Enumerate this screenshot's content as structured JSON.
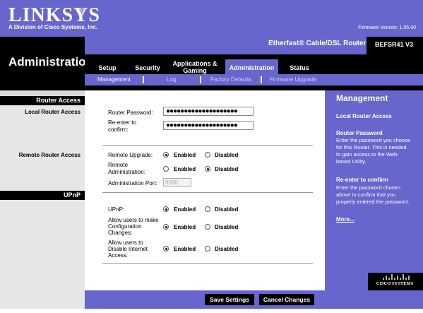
{
  "brand": {
    "logo": "LINKSYS",
    "registered": "®",
    "tagline": "A Division of Cisco Systems, Inc.",
    "firmware": "Firmware Version: 1.05.00"
  },
  "product": {
    "name": "Etherfast® Cable/DSL Router",
    "model": "BEFSR41 V3"
  },
  "section_title": "Administration",
  "tabs": [
    {
      "label": "Setup"
    },
    {
      "label": "Security"
    },
    {
      "label": "Applications & Gaming"
    },
    {
      "label": "Administration"
    },
    {
      "label": "Status"
    }
  ],
  "subtabs": [
    {
      "label": "Management"
    },
    {
      "label": "Log"
    },
    {
      "label": "Factory Defaults"
    },
    {
      "label": "Firmware Upgrade"
    }
  ],
  "left": {
    "router_access_header": "Router Access",
    "local_router_access": "Local Router Access",
    "remote_router_access": "Remote Router Access",
    "upnp_header": "UPnP"
  },
  "form": {
    "router_password_label": "Router Password:",
    "router_password_value": "●●●●●●●●●●●●●●●●●●●●",
    "reenter_label_1": "Re-enter to",
    "reenter_label_2": "confirm:",
    "reenter_value": "●●●●●●●●●●●●●●●●●●●●",
    "remote_upgrade_label": "Remote Upgrade:",
    "remote_admin_label_1": "Remote",
    "remote_admin_label_2": "Administration:",
    "admin_port_label": "Administration Port:",
    "admin_port_value": "8080",
    "upnp_label": "UPnP:",
    "allow_config_1": "Allow users to make",
    "allow_config_2": "Configuration",
    "allow_config_3": "Changes:",
    "allow_disable_1": "Allow users to",
    "allow_disable_2": "Disable Internet",
    "allow_disable_3": "Access:",
    "enabled": "Enabled",
    "disabled": "Disabled"
  },
  "help": {
    "title": "Management",
    "local_router_access": "Local Router Access",
    "router_password_title": "Router Password",
    "router_password_text": [
      "Enter the password you choose",
      "for this Router. This is needed",
      "to gain access to the Web-",
      "based Utility."
    ],
    "reenter_title": "Re-enter to confirm",
    "reenter_text": [
      "Enter the password chosen",
      "above to confirm that you",
      "properly entered the password."
    ],
    "more": "More..."
  },
  "cisco": "CISCO SYSTEMS",
  "buttons": {
    "save": "Save Settings",
    "cancel": "Cancel Changes"
  }
}
